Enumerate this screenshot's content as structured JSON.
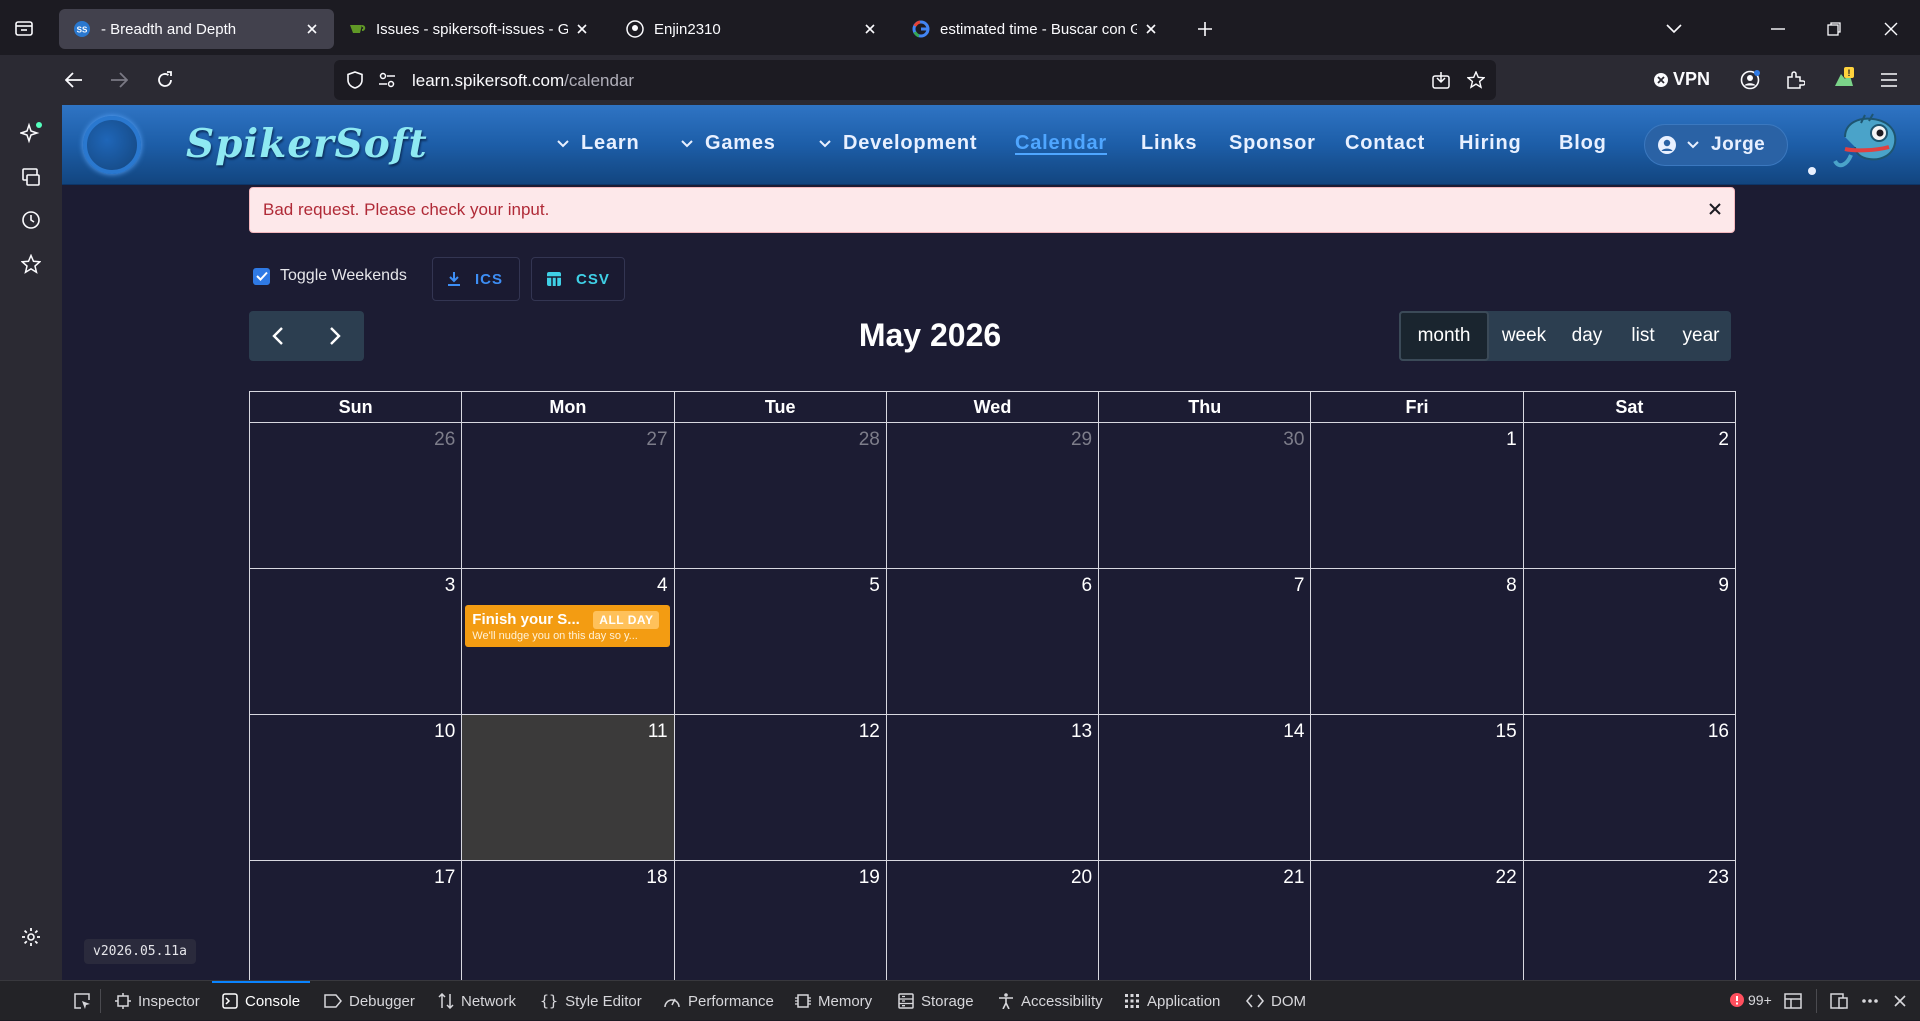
{
  "browser": {
    "tabs": [
      {
        "title": "- Breadth and Depth",
        "active": true,
        "favicon": "spikersoft-icon"
      },
      {
        "title": "Issues - spikersoft-issues - Gitea",
        "active": false,
        "favicon": "gitea-icon"
      },
      {
        "title": "Enjin2310",
        "active": false,
        "favicon": "github-icon"
      },
      {
        "title": "estimated time - Buscar con Google",
        "active": false,
        "favicon": "google-icon"
      }
    ],
    "url_domain": "learn.spikersoft.com",
    "url_path": "/calendar",
    "vpn_label": "VPN"
  },
  "site": {
    "brand": "SpikerSoft",
    "nav": [
      {
        "label": "Learn",
        "dropdown": true
      },
      {
        "label": "Games",
        "dropdown": true
      },
      {
        "label": "Development",
        "dropdown": true
      },
      {
        "label": "Calendar",
        "active": true
      },
      {
        "label": "Links"
      },
      {
        "label": "Sponsor"
      },
      {
        "label": "Contact"
      },
      {
        "label": "Hiring"
      },
      {
        "label": "Blog"
      }
    ],
    "user_name": "Jorge"
  },
  "alert": {
    "message": "Bad request. Please check your input."
  },
  "toolbar": {
    "toggle_weekends_label": "Toggle Weekends",
    "toggle_weekends_checked": true,
    "ics_label": "ICS",
    "csv_label": "CSV"
  },
  "calendar": {
    "title": "May 2026",
    "views": [
      {
        "label": "month",
        "active": true
      },
      {
        "label": "week"
      },
      {
        "label": "day"
      },
      {
        "label": "list"
      },
      {
        "label": "year"
      }
    ],
    "weekdays": [
      "Sun",
      "Mon",
      "Tue",
      "Wed",
      "Thu",
      "Fri",
      "Sat"
    ],
    "weeks": [
      [
        {
          "day": "26",
          "other": true
        },
        {
          "day": "27",
          "other": true
        },
        {
          "day": "28",
          "other": true
        },
        {
          "day": "29",
          "other": true
        },
        {
          "day": "30",
          "other": true
        },
        {
          "day": "1"
        },
        {
          "day": "2"
        }
      ],
      [
        {
          "day": "3"
        },
        {
          "day": "4",
          "event": {
            "title": "Finish your S...",
            "badge": "ALL DAY",
            "desc": "We'll nudge you on this day so y..."
          }
        },
        {
          "day": "5"
        },
        {
          "day": "6"
        },
        {
          "day": "7"
        },
        {
          "day": "8"
        },
        {
          "day": "9"
        }
      ],
      [
        {
          "day": "10"
        },
        {
          "day": "11",
          "today": true
        },
        {
          "day": "12"
        },
        {
          "day": "13"
        },
        {
          "day": "14"
        },
        {
          "day": "15"
        },
        {
          "day": "16"
        }
      ],
      [
        {
          "day": "17"
        },
        {
          "day": "18"
        },
        {
          "day": "19"
        },
        {
          "day": "20"
        },
        {
          "day": "21"
        },
        {
          "day": "22"
        },
        {
          "day": "23"
        }
      ]
    ],
    "event_color": "#f39c12",
    "today_color": "#3b3a3a"
  },
  "version": "v2026.05.11a",
  "devtools": {
    "tabs": [
      {
        "label": "Inspector",
        "icon": "inspector-icon"
      },
      {
        "label": "Console",
        "icon": "console-icon",
        "active": true
      },
      {
        "label": "Debugger",
        "icon": "debugger-icon"
      },
      {
        "label": "Network",
        "icon": "network-icon"
      },
      {
        "label": "Style Editor",
        "icon": "style-editor-icon"
      },
      {
        "label": "Performance",
        "icon": "performance-icon"
      },
      {
        "label": "Memory",
        "icon": "memory-icon"
      },
      {
        "label": "Storage",
        "icon": "storage-icon"
      },
      {
        "label": "Accessibility",
        "icon": "accessibility-icon"
      },
      {
        "label": "Application",
        "icon": "application-icon"
      },
      {
        "label": "DOM",
        "icon": "dom-icon"
      }
    ],
    "error_count": "99+"
  }
}
